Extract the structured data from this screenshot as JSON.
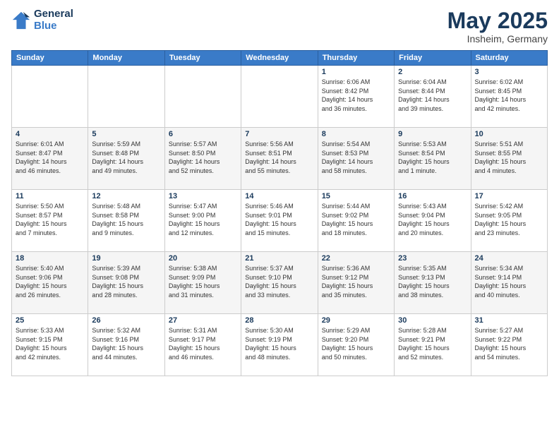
{
  "logo": {
    "line1": "General",
    "line2": "Blue"
  },
  "title": "May 2025",
  "location": "Insheim, Germany",
  "weekdays": [
    "Sunday",
    "Monday",
    "Tuesday",
    "Wednesday",
    "Thursday",
    "Friday",
    "Saturday"
  ],
  "weeks": [
    [
      {
        "day": "",
        "info": ""
      },
      {
        "day": "",
        "info": ""
      },
      {
        "day": "",
        "info": ""
      },
      {
        "day": "",
        "info": ""
      },
      {
        "day": "1",
        "info": "Sunrise: 6:06 AM\nSunset: 8:42 PM\nDaylight: 14 hours\nand 36 minutes."
      },
      {
        "day": "2",
        "info": "Sunrise: 6:04 AM\nSunset: 8:44 PM\nDaylight: 14 hours\nand 39 minutes."
      },
      {
        "day": "3",
        "info": "Sunrise: 6:02 AM\nSunset: 8:45 PM\nDaylight: 14 hours\nand 42 minutes."
      }
    ],
    [
      {
        "day": "4",
        "info": "Sunrise: 6:01 AM\nSunset: 8:47 PM\nDaylight: 14 hours\nand 46 minutes."
      },
      {
        "day": "5",
        "info": "Sunrise: 5:59 AM\nSunset: 8:48 PM\nDaylight: 14 hours\nand 49 minutes."
      },
      {
        "day": "6",
        "info": "Sunrise: 5:57 AM\nSunset: 8:50 PM\nDaylight: 14 hours\nand 52 minutes."
      },
      {
        "day": "7",
        "info": "Sunrise: 5:56 AM\nSunset: 8:51 PM\nDaylight: 14 hours\nand 55 minutes."
      },
      {
        "day": "8",
        "info": "Sunrise: 5:54 AM\nSunset: 8:53 PM\nDaylight: 14 hours\nand 58 minutes."
      },
      {
        "day": "9",
        "info": "Sunrise: 5:53 AM\nSunset: 8:54 PM\nDaylight: 15 hours\nand 1 minute."
      },
      {
        "day": "10",
        "info": "Sunrise: 5:51 AM\nSunset: 8:55 PM\nDaylight: 15 hours\nand 4 minutes."
      }
    ],
    [
      {
        "day": "11",
        "info": "Sunrise: 5:50 AM\nSunset: 8:57 PM\nDaylight: 15 hours\nand 7 minutes."
      },
      {
        "day": "12",
        "info": "Sunrise: 5:48 AM\nSunset: 8:58 PM\nDaylight: 15 hours\nand 9 minutes."
      },
      {
        "day": "13",
        "info": "Sunrise: 5:47 AM\nSunset: 9:00 PM\nDaylight: 15 hours\nand 12 minutes."
      },
      {
        "day": "14",
        "info": "Sunrise: 5:46 AM\nSunset: 9:01 PM\nDaylight: 15 hours\nand 15 minutes."
      },
      {
        "day": "15",
        "info": "Sunrise: 5:44 AM\nSunset: 9:02 PM\nDaylight: 15 hours\nand 18 minutes."
      },
      {
        "day": "16",
        "info": "Sunrise: 5:43 AM\nSunset: 9:04 PM\nDaylight: 15 hours\nand 20 minutes."
      },
      {
        "day": "17",
        "info": "Sunrise: 5:42 AM\nSunset: 9:05 PM\nDaylight: 15 hours\nand 23 minutes."
      }
    ],
    [
      {
        "day": "18",
        "info": "Sunrise: 5:40 AM\nSunset: 9:06 PM\nDaylight: 15 hours\nand 26 minutes."
      },
      {
        "day": "19",
        "info": "Sunrise: 5:39 AM\nSunset: 9:08 PM\nDaylight: 15 hours\nand 28 minutes."
      },
      {
        "day": "20",
        "info": "Sunrise: 5:38 AM\nSunset: 9:09 PM\nDaylight: 15 hours\nand 31 minutes."
      },
      {
        "day": "21",
        "info": "Sunrise: 5:37 AM\nSunset: 9:10 PM\nDaylight: 15 hours\nand 33 minutes."
      },
      {
        "day": "22",
        "info": "Sunrise: 5:36 AM\nSunset: 9:12 PM\nDaylight: 15 hours\nand 35 minutes."
      },
      {
        "day": "23",
        "info": "Sunrise: 5:35 AM\nSunset: 9:13 PM\nDaylight: 15 hours\nand 38 minutes."
      },
      {
        "day": "24",
        "info": "Sunrise: 5:34 AM\nSunset: 9:14 PM\nDaylight: 15 hours\nand 40 minutes."
      }
    ],
    [
      {
        "day": "25",
        "info": "Sunrise: 5:33 AM\nSunset: 9:15 PM\nDaylight: 15 hours\nand 42 minutes."
      },
      {
        "day": "26",
        "info": "Sunrise: 5:32 AM\nSunset: 9:16 PM\nDaylight: 15 hours\nand 44 minutes."
      },
      {
        "day": "27",
        "info": "Sunrise: 5:31 AM\nSunset: 9:17 PM\nDaylight: 15 hours\nand 46 minutes."
      },
      {
        "day": "28",
        "info": "Sunrise: 5:30 AM\nSunset: 9:19 PM\nDaylight: 15 hours\nand 48 minutes."
      },
      {
        "day": "29",
        "info": "Sunrise: 5:29 AM\nSunset: 9:20 PM\nDaylight: 15 hours\nand 50 minutes."
      },
      {
        "day": "30",
        "info": "Sunrise: 5:28 AM\nSunset: 9:21 PM\nDaylight: 15 hours\nand 52 minutes."
      },
      {
        "day": "31",
        "info": "Sunrise: 5:27 AM\nSunset: 9:22 PM\nDaylight: 15 hours\nand 54 minutes."
      }
    ]
  ]
}
